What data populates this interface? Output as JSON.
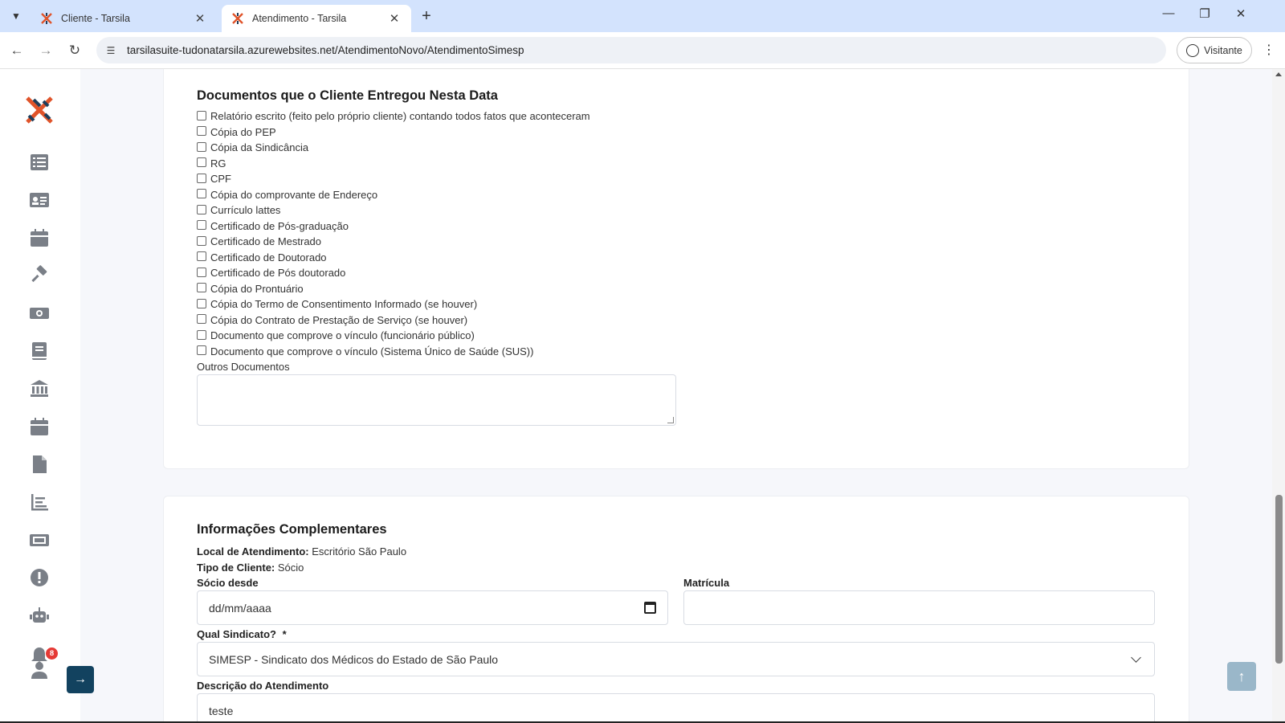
{
  "browser": {
    "tabs": [
      {
        "title": "Cliente - Tarsila",
        "active": false
      },
      {
        "title": "Atendimento - Tarsila",
        "active": true
      }
    ],
    "url": "tarsilasuite-tudonatarsila.azurewebsites.net/AtendimentoNovo/AtendimentoSimesp",
    "profile_label": "Visitante"
  },
  "sidebar": {
    "icons": [
      "list-icon",
      "id-card-icon",
      "calendar-icon",
      "gavel-icon",
      "money-icon",
      "book-icon",
      "bank-icon",
      "calendar-icon",
      "file-icon",
      "chart-icon",
      "ticket-icon",
      "alert-icon",
      "robot-icon",
      "bell-icon",
      "user-icon"
    ],
    "notification_count": "8"
  },
  "documents": {
    "title": "Documentos que o Cliente Entregou Nesta Data",
    "items": [
      "Relatório escrito (feito pelo próprio cliente) contando todos fatos que aconteceram",
      "Cópia do PEP",
      "Cópia da Sindicância",
      "RG",
      "CPF",
      "Cópia do comprovante de Endereço",
      "Currículo lattes",
      "Certificado de Pós-graduação",
      "Certificado de Mestrado",
      "Certificado de Doutorado",
      "Certificado de Pós doutorado",
      "Cópia do Prontuário",
      "Cópia do Termo de Consentimento Informado (se houver)",
      "Cópia do Contrato de Prestação de Serviço (se houver)",
      "Documento que comprove o vínculo (funcionário público)",
      "Documento que comprove o vínculo (Sistema Único de Saúde (SUS))"
    ],
    "others_label": "Outros Documentos",
    "others_value": ""
  },
  "complementary": {
    "title": "Informações Complementares",
    "local_label": "Local de Atendimento:",
    "local_value": "Escritório São Paulo",
    "tipo_label": "Tipo de Cliente:",
    "tipo_value": "Sócio",
    "socio_desde_label": "Sócio desde",
    "socio_desde_placeholder": "dd/mm/aaaa",
    "matricula_label": "Matrícula",
    "matricula_value": "",
    "sindicato_label": "Qual Sindicato?",
    "required_mark": "*",
    "sindicato_value": "SIMESP - Sindicato dos Médicos do Estado de São Paulo",
    "descricao_label": "Descrição do Atendimento",
    "descricao_value": "teste"
  }
}
